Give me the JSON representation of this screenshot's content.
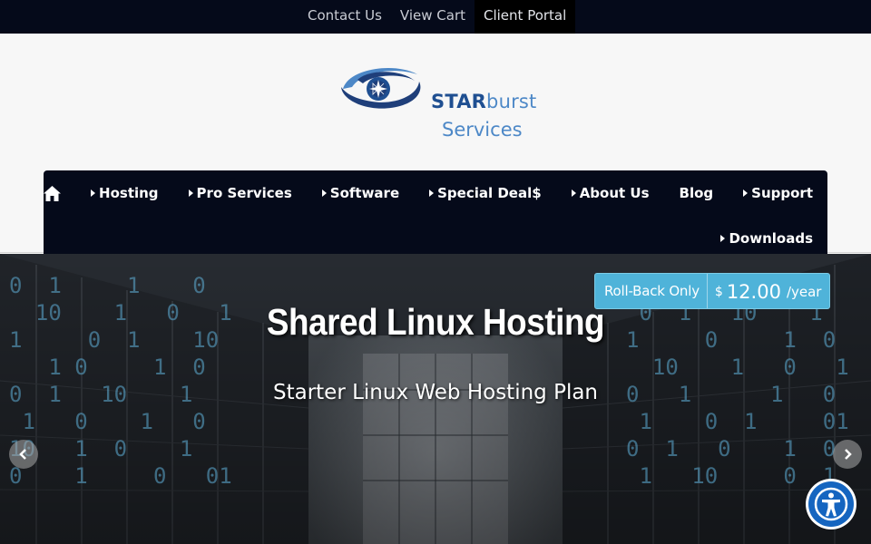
{
  "topbar": {
    "links": [
      {
        "label": "Contact Us"
      },
      {
        "label": "View Cart"
      },
      {
        "label": "Client Portal"
      }
    ]
  },
  "logo": {
    "line1_bold": "STAR",
    "line1_light": "burst",
    "line2": "Services",
    "colors": {
      "dark": "#1f4f91",
      "light": "#4d88c7"
    }
  },
  "nav": {
    "home_icon": "home-icon",
    "items": [
      {
        "label": "Hosting",
        "has_dropdown": true
      },
      {
        "label": "Pro Services",
        "has_dropdown": true
      },
      {
        "label": "Software",
        "has_dropdown": true
      },
      {
        "label": "Special Deal$",
        "has_dropdown": true
      },
      {
        "label": "About Us",
        "has_dropdown": true
      },
      {
        "label": "Blog",
        "has_dropdown": false
      },
      {
        "label": "Support",
        "has_dropdown": true
      },
      {
        "label": "Downloads",
        "has_dropdown": true
      }
    ]
  },
  "hero": {
    "title": "Shared Linux Hosting",
    "subtitle": "Starter Linux Web Hosting Plan",
    "price": {
      "label": "Roll-Back Only",
      "currency": "$",
      "amount": "12.00",
      "period": "/year"
    },
    "prev_icon": "chevron-left-icon",
    "next_icon": "chevron-right-icon"
  },
  "accessibility": {
    "icon": "accessibility-icon"
  },
  "colors": {
    "topbar_bg": "#050a1a",
    "nav_bg": "#050a1a",
    "price_badge": "#4fb3d9",
    "accessibility": "#1565c0"
  }
}
